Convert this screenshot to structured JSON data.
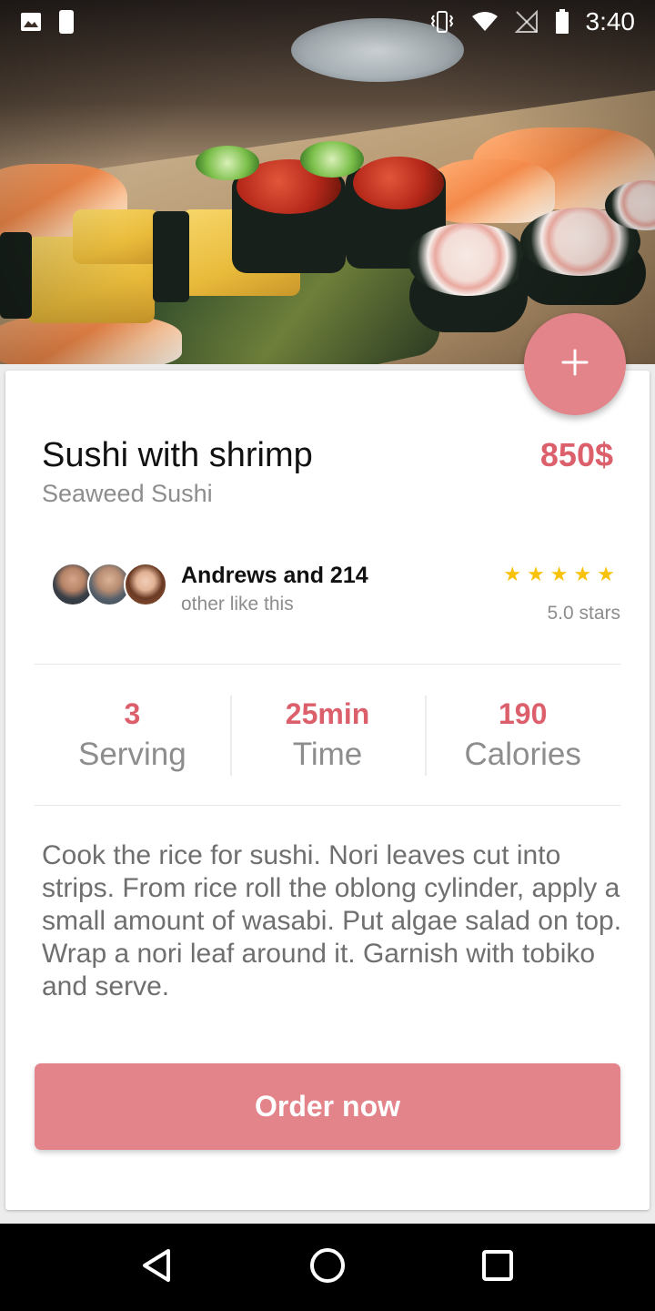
{
  "status_bar": {
    "time": "3:40",
    "icons": [
      "image-icon",
      "moon-alarm-icon",
      "vibrate-icon",
      "wifi-icon",
      "no-sim-icon",
      "battery-icon"
    ]
  },
  "hero": {
    "subject": "sushi platter photo"
  },
  "fab": {
    "icon": "plus-icon"
  },
  "dish": {
    "title": "Sushi with shrimp",
    "subtitle": "Seaweed Sushi",
    "price": "850$"
  },
  "social": {
    "name": "Andrews and 214",
    "sub": "other like this",
    "rating": 5,
    "rating_text": "5.0 stars"
  },
  "stats": [
    {
      "value": "3",
      "label": "Serving"
    },
    {
      "value": "25min",
      "label": "Time"
    },
    {
      "value": "190",
      "label": "Calories"
    }
  ],
  "description": "Cook the rice for sushi. Nori leaves cut into strips. From rice roll the oblong cylinder, apply a small amount of wasabi. Put algae salad on top. Wrap a nori leaf around it. Garnish with tobiko and serve.",
  "order": {
    "label": "Order now"
  },
  "colors": {
    "accent": "#e3838a",
    "price": "#dc5f6c",
    "star": "#f8c20a"
  },
  "nav": {
    "icons": [
      "back-triangle-icon",
      "home-circle-icon",
      "recents-square-icon"
    ]
  }
}
